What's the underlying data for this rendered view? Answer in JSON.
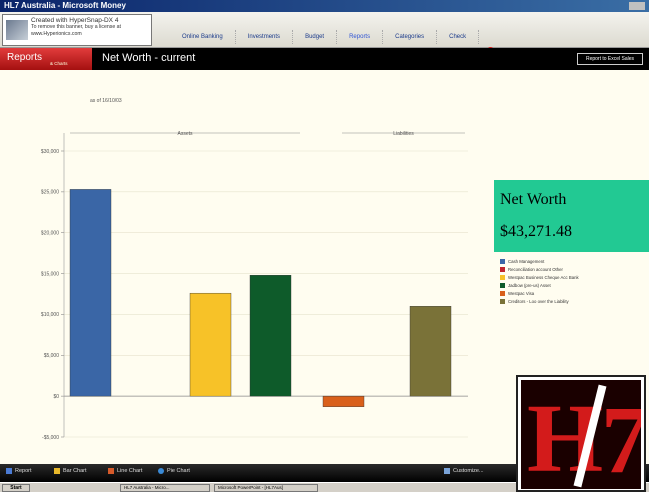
{
  "window": {
    "title": "HL7 Australia - Microsoft Money"
  },
  "watermark": {
    "line1": "Created with HyperSnap-DX 4",
    "line2": "To remove this banner, buy a license at",
    "line3": "www.Hyperionics.com"
  },
  "nav": {
    "items": [
      "Online Banking",
      "Investments",
      "Budget",
      "Reports",
      "Categories",
      "Check"
    ]
  },
  "reports_bar": {
    "tab_label": "Reports",
    "tab_sub": "& Charts",
    "title": "Net Worth - current",
    "export_button": "Report to Excel Sales"
  },
  "as_of": "as of 16/10/03",
  "networth": {
    "label": "Net Worth",
    "value": "$43,271.48"
  },
  "chart_data": {
    "type": "bar",
    "group_labels": [
      "Assets",
      "Liabilities"
    ],
    "yticks": [
      "$30,000",
      "$25,000",
      "$20,000",
      "$15,000",
      "$10,000",
      "$5,000",
      "$0",
      "-$5,000"
    ],
    "ylim": [
      -5000,
      30000
    ],
    "grid": true,
    "legend_position": "right",
    "series": [
      {
        "name": "Cash Management",
        "value": 25300,
        "color": "#3a66a6"
      },
      {
        "name": "Reconciliation account Other",
        "value": 0,
        "color": "#c0262d"
      },
      {
        "name": "Westpac Business Cheque Acc Bank",
        "value": 12600,
        "color": "#f7c228"
      },
      {
        "name": "Jadbow (pre-us) Asset",
        "value": 14800,
        "color": "#0e5b2a"
      },
      {
        "name": "Westpac Visa",
        "value": -1300,
        "color": "#d9601b"
      },
      {
        "name": "Creditors - Loo over the Liability",
        "value": 11000,
        "color": "#7a7238"
      }
    ]
  },
  "bottom_toolbar": {
    "items": [
      "Report",
      "Bar Chart",
      "Line Chart",
      "Pie Chart"
    ],
    "customize": "Customize..."
  },
  "taskbar": {
    "start": "Start",
    "tasks": [
      "HL7 Australia - Micro...",
      "Microsoft PowerPoint - [HL7Aus]"
    ]
  }
}
